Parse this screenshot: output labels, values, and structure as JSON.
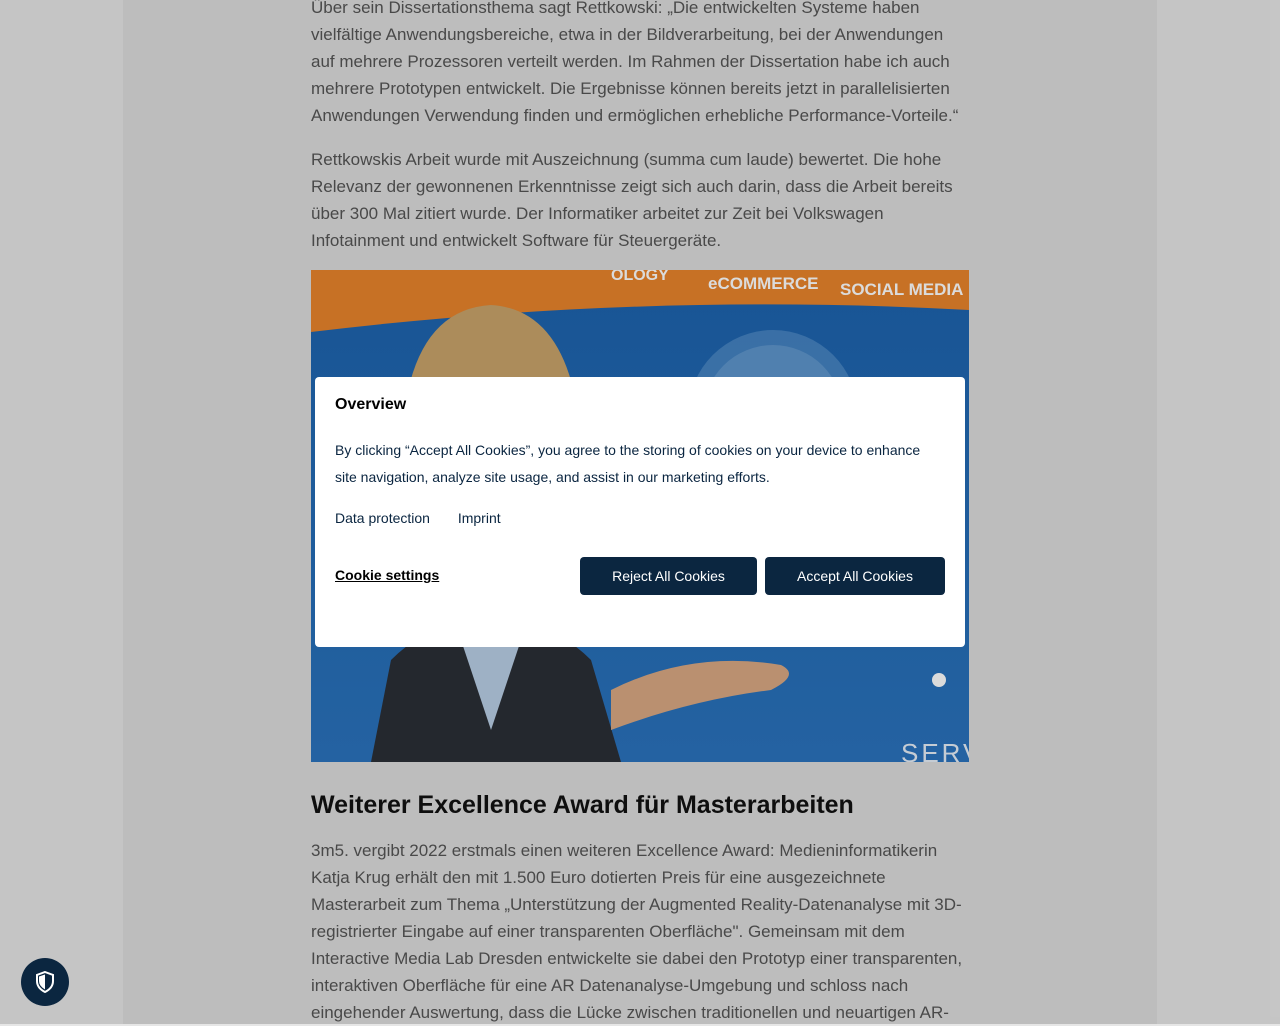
{
  "article": {
    "paragraph_1": "Über sein Dissertationsthema sagt Rettkowski: „Die entwickelten Systeme haben vielfältige Anwendungsbereiche, etwa in der Bildverarbeitung, bei der Anwendungen auf mehrere Prozessoren verteilt werden. Im Rahmen der Dissertation habe ich auch mehrere Prototypen entwickelt. Die Ergebnisse können bereits jetzt in parallelisierten Anwendungen Verwendung finden und ermöglichen erhebliche Performance-Vorteile.“",
    "paragraph_2": "Rettkowskis Arbeit wurde mit Auszeichnung (summa cum laude) bewertet. Die hohe Relevanz der gewonnenen Erkenntnisse zeigt sich auch darin, dass die Arbeit bereits über 300 Mal zitiert wurde. Der Informatiker arbeitet zur Zeit bei Volkswagen Infotainment und entwickelt Software für Steuergeräte.",
    "image": {
      "banner_texts": [
        "OLOGY",
        "eCOMMERCE",
        "SOCIAL MEDIA"
      ],
      "bottom_text": "SERVICES"
    },
    "heading": "Weiterer Excellence Award für Masterarbeiten",
    "paragraph_3": "3m5. vergibt 2022 erstmals einen weiteren Excellence Award: Medieninformatikerin Katja Krug erhält den mit 1.500 Euro dotierten Preis für eine ausgezeichnete Masterarbeit zum Thema „Unterstützung der Augmented Reality-Datenanalyse mit 3D-registrierter Eingabe auf einer transparenten Oberfläche\". Gemeinsam mit dem Interactive Media Lab Dresden entwickelte sie dabei den Prototyp einer transparenten, interaktiven Oberfläche für eine AR Datenanalyse-Umgebung und schloss nach eingehender Auswertung, dass die Lücke zwischen traditionellen und neuartigen AR-"
  },
  "cookie_modal": {
    "title": "Overview",
    "text": "By clicking “Accept All Cookies”, you agree to the storing of cookies on your device to enhance site navigation, analyze site usage, and assist in our marketing efforts.",
    "links": [
      "Data protection",
      "Imprint"
    ],
    "settings_label": "Cookie settings",
    "reject_label": "Reject All Cookies",
    "accept_label": "Accept All Cookies"
  },
  "privacy_button": {
    "icon": "shield-icon"
  },
  "colors": {
    "button_bg": "#0b2640",
    "page_bg": "#e6e6e6",
    "content_bg": "#dcdcdc",
    "banner_orange": "#e8842c",
    "banner_blue": "#1a5fa8"
  }
}
